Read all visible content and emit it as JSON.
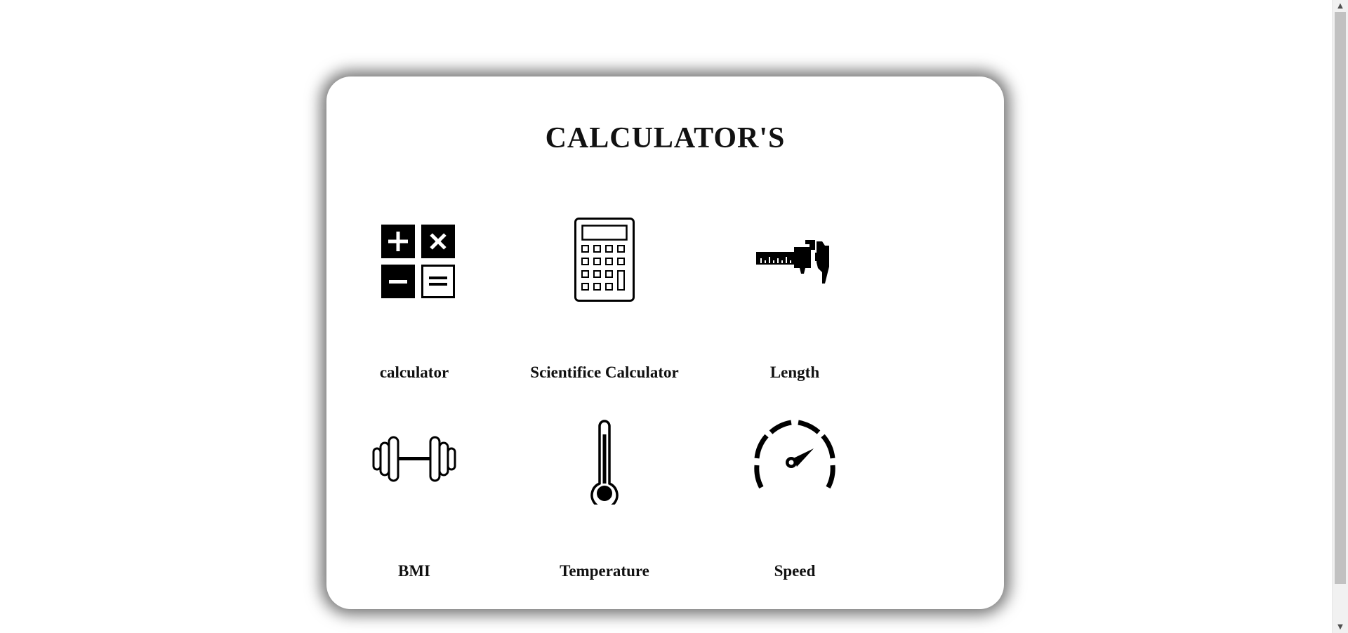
{
  "page": {
    "title": "CALCULATOR'S"
  },
  "tiles": [
    {
      "label": "calculator",
      "icon": "calculator-ops-icon"
    },
    {
      "label": "Scientifice Calculator",
      "icon": "scientific-calculator-icon"
    },
    {
      "label": "Length",
      "icon": "caliper-icon"
    },
    {
      "label": "BMI",
      "icon": "dumbbell-icon"
    },
    {
      "label": "Temperature",
      "icon": "thermometer-icon"
    },
    {
      "label": "Speed",
      "icon": "speedometer-icon"
    }
  ],
  "colors": {
    "background": "#ffffff",
    "text": "#111111",
    "icon": "#000000",
    "card_shadow": "#555555"
  }
}
